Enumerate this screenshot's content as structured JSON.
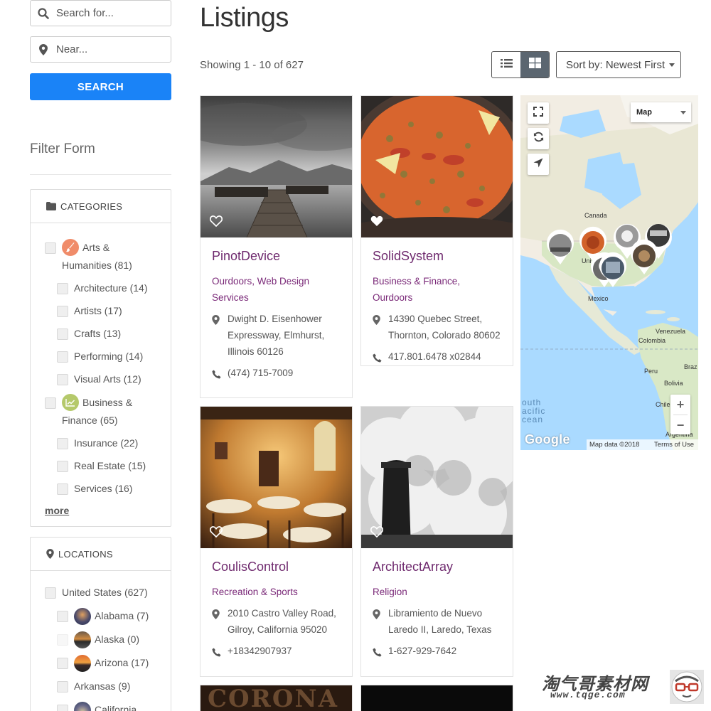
{
  "search": {
    "keyword_placeholder": "Search for...",
    "location_placeholder": "Near...",
    "button_label": "SEARCH"
  },
  "filter": {
    "title": "Filter Form",
    "categories_header": "CATEGORIES",
    "categories": [
      {
        "label": "Arts & Humanities (81)",
        "line1": "Arts &",
        "line2": "Humanities (81)",
        "badge_color": "#f08c6a",
        "icon": "brush-icon"
      },
      {
        "label": "Architecture (14)"
      },
      {
        "label": "Artists (17)"
      },
      {
        "label": "Crafts (13)"
      },
      {
        "label": "Performing (14)"
      },
      {
        "label": "Visual Arts (12)"
      },
      {
        "label": "Business & Finance (65)",
        "line1": "Business &",
        "line2": "Finance (65)",
        "badge_color": "#b5c96b",
        "icon": "chart-line-icon"
      },
      {
        "label": "Insurance (22)"
      },
      {
        "label": "Real Estate (15)"
      },
      {
        "label": "Services (16)"
      }
    ],
    "more_label": "more",
    "locations_header": "LOCATIONS",
    "locations": [
      {
        "label": "United States (627)"
      },
      {
        "label": "Alabama (7)"
      },
      {
        "label": "Alaska (0)"
      },
      {
        "label": "Arizona (17)"
      },
      {
        "label": "Arkansas (9)"
      },
      {
        "label": "California"
      }
    ]
  },
  "main": {
    "title": "Listings",
    "count_text": "Showing 1 - 10 of 627",
    "sort_label": "Sort by: Newest First"
  },
  "listings": [
    {
      "name": "PinotDevice",
      "categories": "Ourdoors, Web Design Services",
      "address": "Dwight D. Eisenhower Expressway, Elmhurst, Illinois 60126",
      "phone": "(474) 715-7009"
    },
    {
      "name": "SolidSystem",
      "categories": "Business & Finance, Ourdoors",
      "address": "14390 Quebec Street, Thornton, Colorado 80602",
      "phone": "417.801.6478 x02844"
    },
    {
      "name": "CoulisControl",
      "categories": "Recreation & Sports",
      "address": "2010 Castro Valley Road, Gilroy, California 95020",
      "phone": "+18342907937"
    },
    {
      "name": "ArchitectArray",
      "categories": "Religion",
      "address": "Libramiento de Nuevo Laredo II, Laredo, Texas",
      "phone": "1-627-929-7642"
    },
    {
      "name_image_text": "CORONA"
    }
  ],
  "map": {
    "type_label": "Map",
    "labels": {
      "canada": "Canada",
      "united": "Unite",
      "mexico": "Mexico",
      "venezuela": "Venezuela",
      "colombia": "Colombia",
      "peru": "Peru",
      "bolivia": "Bolivia",
      "chile": "Chile",
      "brazil": "Braz",
      "argentina": "Argentina"
    },
    "ocean_line1": "outh",
    "ocean_line2": "acific",
    "ocean_line3": "cean",
    "zoom_in": "+",
    "zoom_out": "−",
    "google": "Google",
    "map_data": "Map data ©2018",
    "terms": "Terms of Use"
  },
  "watermark": {
    "chinese": "淘气哥素材网",
    "url": "www.tqge.com"
  },
  "colors": {
    "accent_blue": "#1a83f7",
    "listing_title": "#6f2a6e",
    "category_link": "#7a2978"
  }
}
